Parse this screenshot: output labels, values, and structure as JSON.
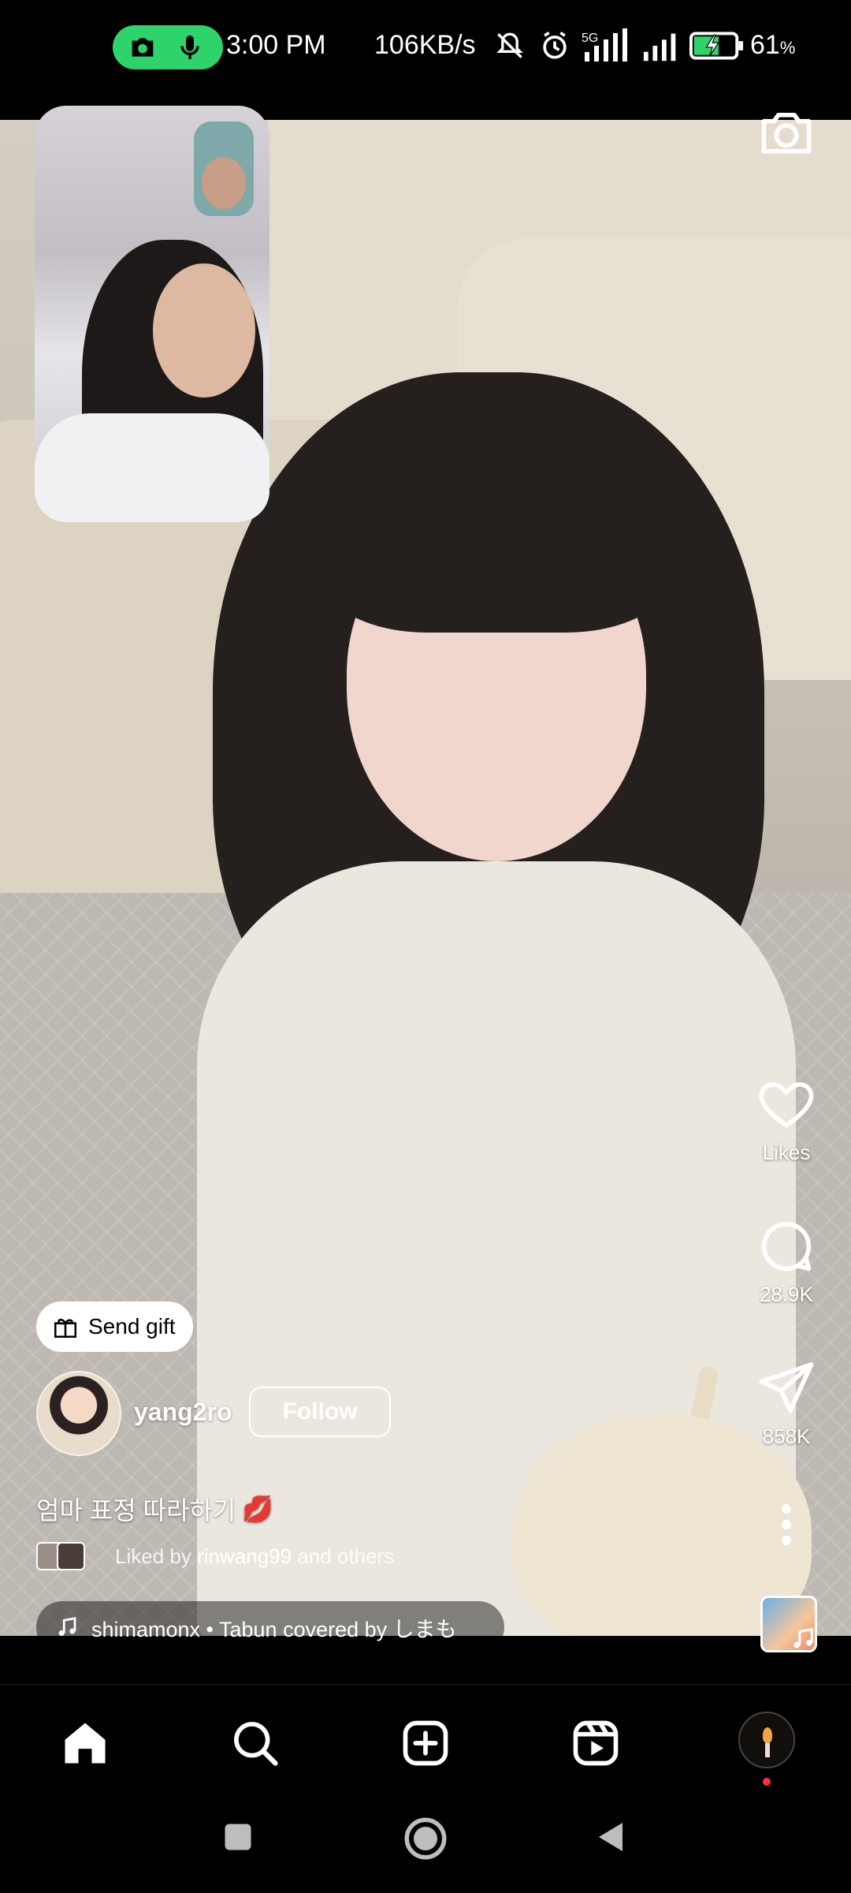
{
  "status_bar": {
    "time": "3:00 PM",
    "net_speed": "106KB/s",
    "network_type": "5G",
    "battery_percent": "61",
    "battery_unit": "%",
    "icons": [
      "camera-icon",
      "mic-icon",
      "mute-icon",
      "alarm-icon",
      "signal-icon",
      "battery-charging-icon"
    ],
    "call_pill_color": "#2ed36b"
  },
  "reel": {
    "actions": {
      "likes_label": "Likes",
      "comments_count": "28.9K",
      "shares_count": "858K"
    },
    "send_gift_label": "Send gift",
    "author": {
      "username": "yang2ro",
      "follow_label": "Follow"
    },
    "caption": "엄마 표정 따라하기",
    "caption_emoji": "💋",
    "liked_by": {
      "prefix": "Liked by",
      "user": "rinwang99",
      "suffix": "and others"
    },
    "audio": {
      "text": "shimamonx • Tabun covered by しまも"
    }
  },
  "bottom_nav": {
    "items": [
      "home-icon",
      "search-icon",
      "create-icon",
      "reels-icon",
      "profile-avatar"
    ],
    "notification_dot_color": "#ff3040"
  },
  "system_nav": [
    "recents-button",
    "home-button",
    "back-button"
  ]
}
